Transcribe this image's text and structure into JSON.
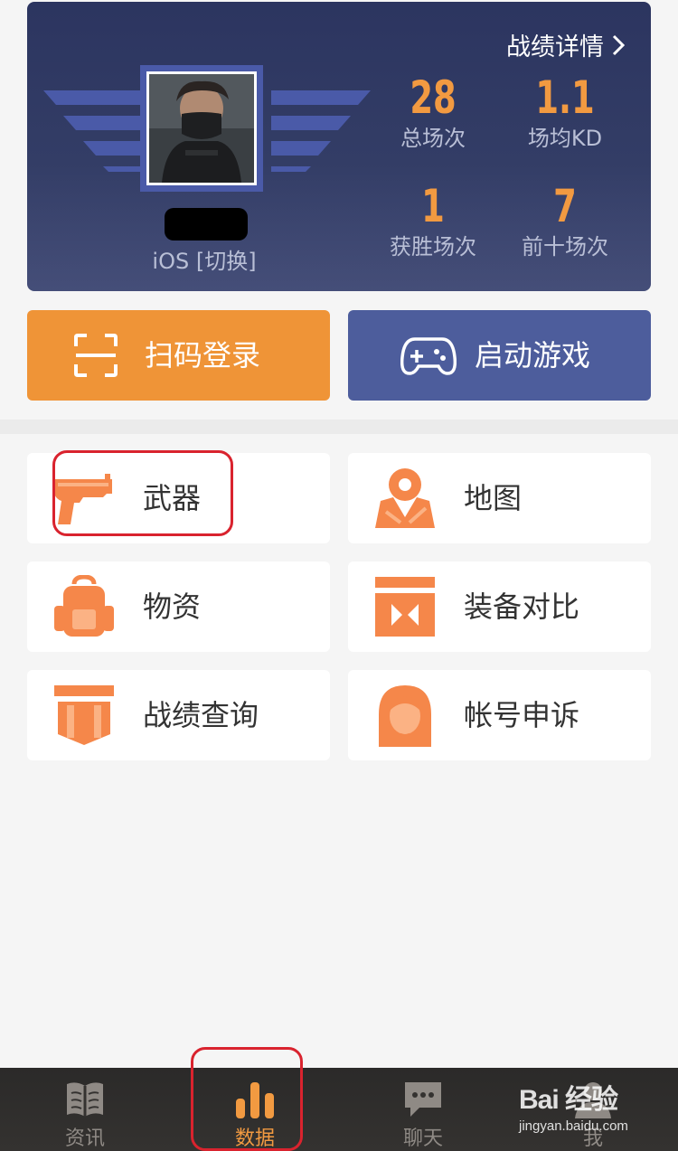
{
  "profile": {
    "platform_text": "iOS [切换]",
    "detail_link": "战绩详情",
    "stats": [
      {
        "value": "28",
        "label": "总场次"
      },
      {
        "value": "1.1",
        "label": "场均KD"
      },
      {
        "value": "1",
        "label": "获胜场次"
      },
      {
        "value": "7",
        "label": "前十场次"
      }
    ]
  },
  "actions": {
    "scan_login": "扫码登录",
    "launch_game": "启动游戏"
  },
  "grid": {
    "weapons": "武器",
    "map": "地图",
    "supplies": "物资",
    "gear_compare": "装备对比",
    "record_query": "战绩查询",
    "account_appeal": "帐号申诉"
  },
  "nav": {
    "news": "资讯",
    "data": "数据",
    "chat": "聊天",
    "me": "我"
  },
  "watermark": {
    "main": "Bai 经验",
    "sub": "jingyan.baidu.com"
  },
  "colors": {
    "accent_orange": "#ef9437",
    "card_navy": "#2c3560",
    "button_blue": "#4d5d9c",
    "highlight_red": "#d9232e"
  }
}
